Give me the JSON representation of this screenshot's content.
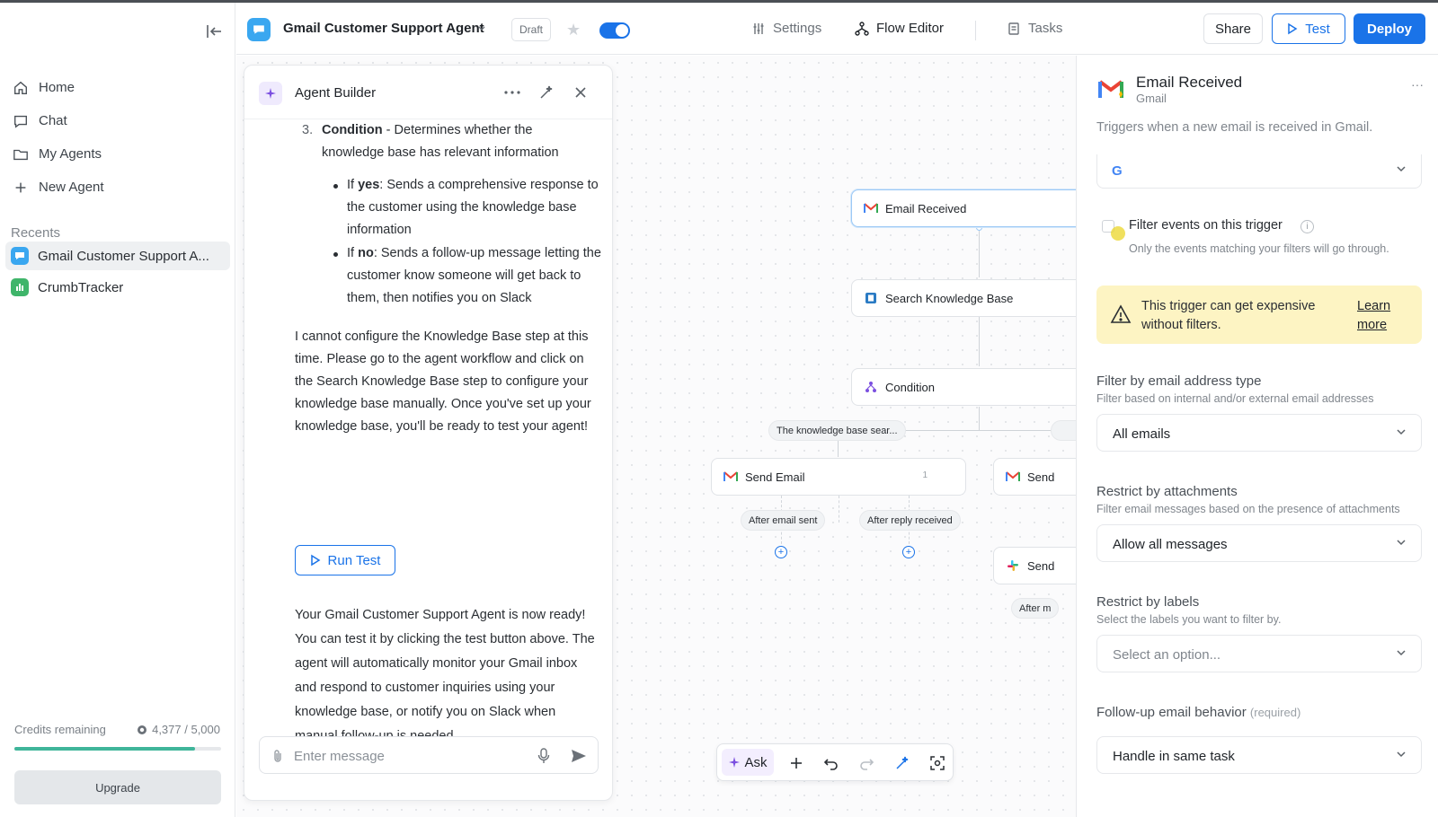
{
  "sidebar": {
    "nav": [
      {
        "label": "Home",
        "icon": "home-icon"
      },
      {
        "label": "Chat",
        "icon": "chat-icon"
      },
      {
        "label": "My Agents",
        "icon": "folder-icon"
      },
      {
        "label": "New Agent",
        "icon": "plus-icon"
      }
    ],
    "recents_title": "Recents",
    "recents": [
      {
        "label": "Gmail Customer Support A...",
        "color": "#3aa7f0",
        "active": true
      },
      {
        "label": "CrumbTracker",
        "color": "#3fb56a",
        "active": false
      }
    ],
    "credits": {
      "label": "Credits remaining",
      "value": "4,377 / 5,000",
      "used_fraction": 0.8754
    },
    "upgrade_label": "Upgrade"
  },
  "header": {
    "agent_title": "Gmail Customer Support Agent",
    "status": "Draft",
    "enabled": true,
    "tabs": [
      {
        "label": "Settings",
        "icon": "sliders-icon",
        "active": false
      },
      {
        "label": "Flow Editor",
        "icon": "flow-icon",
        "active": true
      },
      {
        "label": "Tasks",
        "icon": "tasks-icon",
        "active": false
      }
    ],
    "share_label": "Share",
    "test_label": "Test",
    "deploy_label": "Deploy"
  },
  "builder": {
    "title": "Agent Builder",
    "step_number": "3.",
    "step_title": "Condition",
    "step_text": " - Determines whether the knowledge base has relevant information",
    "bullets": [
      {
        "key": "If ",
        "bold": "yes",
        "text": ": Sends a comprehensive response to the customer using the knowledge base information"
      },
      {
        "key": "If ",
        "bold": "no",
        "text": ": Sends a follow-up message letting the customer know someone will get back to them, then notifies you on Slack"
      }
    ],
    "paragraph1": "I cannot configure the Knowledge Base step at this time. Please go to the agent workflow and click on the Search Knowledge Base step to configure your knowledge base manually. Once you've set up your knowledge base, you'll be ready to test your agent!",
    "run_test_label": "Run Test",
    "paragraph2": "Your Gmail Customer Support Agent is now ready! You can test it by clicking the test button above. The agent will automatically monitor your Gmail inbox and respond to customer inquiries using your knowledge base, or notify you on Slack when manual follow-up is needed.",
    "input_placeholder": "Enter message"
  },
  "flow": {
    "nodes": {
      "email_received": "Email Received",
      "search_kb": "Search Knowledge Base",
      "condition": "Condition",
      "send_email": "Send Email",
      "send_email_count": "1",
      "send_right_1": "Send",
      "send_right_2": "Send"
    },
    "pills": {
      "kb_search": "The knowledge base sear...",
      "after_sent": "After email sent",
      "after_reply": "After reply received",
      "after_right": "After m"
    },
    "toolbar": {
      "ask_label": "Ask"
    }
  },
  "panel": {
    "title": "Email Received",
    "subtitle": "Gmail",
    "description": "Triggers when a new email is received in Gmail.",
    "filter_events_label": "Filter events on this trigger",
    "filter_events_checked": false,
    "filter_events_help": "Only the events matching your filters will go through.",
    "warning_text": "This trigger can get expensive without filters.",
    "warning_link": "Learn more",
    "fields": [
      {
        "label": "Filter by email address type",
        "help": "Filter based on internal and/or external email addresses",
        "value": "All emails",
        "placeholder": false
      },
      {
        "label": "Restrict by attachments",
        "help": "Filter email messages based on the presence of attachments",
        "value": "Allow all messages",
        "placeholder": false
      },
      {
        "label": "Restrict by labels",
        "help": "Select the labels you want to filter by.",
        "value": "Select an option...",
        "placeholder": true
      },
      {
        "label": "Follow-up email behavior",
        "required": "(required)",
        "help": "",
        "value": "Handle in same task",
        "placeholder": false
      }
    ]
  },
  "colors": {
    "accent": "#1a73e8",
    "warning_bg": "#fdf4c3",
    "credits_bar": "#3fb59a",
    "ask_purple": "#7b4fe0"
  }
}
